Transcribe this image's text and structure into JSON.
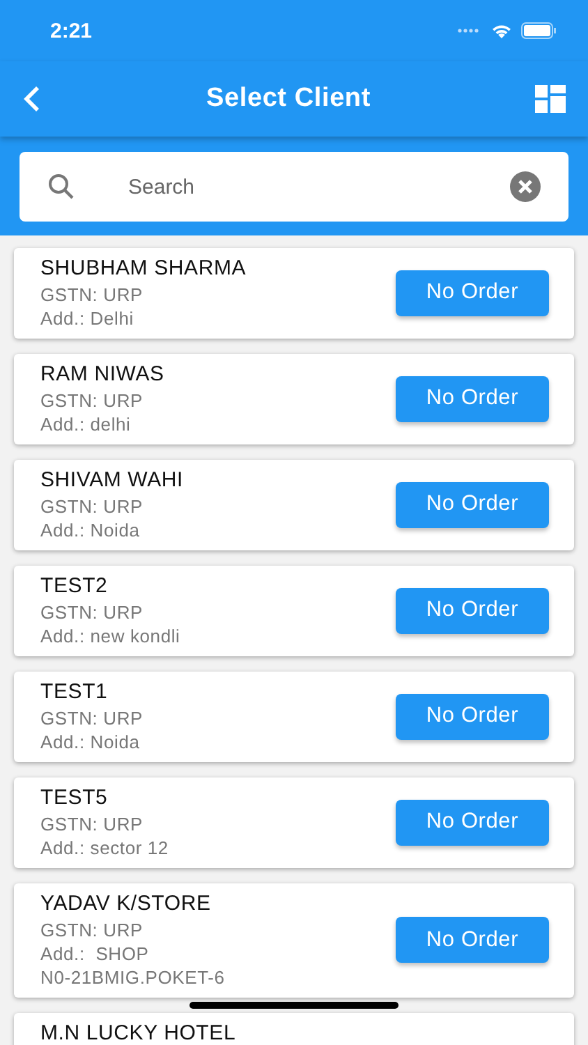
{
  "status_bar": {
    "time": "2:21"
  },
  "app_bar": {
    "title": "Select Client"
  },
  "search": {
    "placeholder": "Search"
  },
  "clients": [
    {
      "name": "SHUBHAM SHARMA",
      "gstn": "GSTN: URP",
      "address": "Add.: Delhi",
      "action": "No Order"
    },
    {
      "name": "RAM NIWAS",
      "gstn": "GSTN: URP",
      "address": "Add.: delhi",
      "action": "No Order"
    },
    {
      "name": "SHIVAM WAHI",
      "gstn": "GSTN: URP",
      "address": "Add.: Noida",
      "action": "No Order"
    },
    {
      "name": "TEST2",
      "gstn": "GSTN: URP",
      "address": "Add.: new kondli",
      "action": "No Order"
    },
    {
      "name": "TEST1",
      "gstn": "GSTN: URP",
      "address": "Add.: Noida",
      "action": "No Order"
    },
    {
      "name": "TEST5",
      "gstn": "GSTN: URP",
      "address": "Add.: sector 12",
      "action": "No Order"
    },
    {
      "name": "YADAV K/STORE",
      "gstn": "GSTN: URP",
      "address": "Add.:  SHOP N0-21BMIG.POKET-6",
      "action": "No Order"
    },
    {
      "name": "M.N LUCKY HOTEL"
    }
  ]
}
